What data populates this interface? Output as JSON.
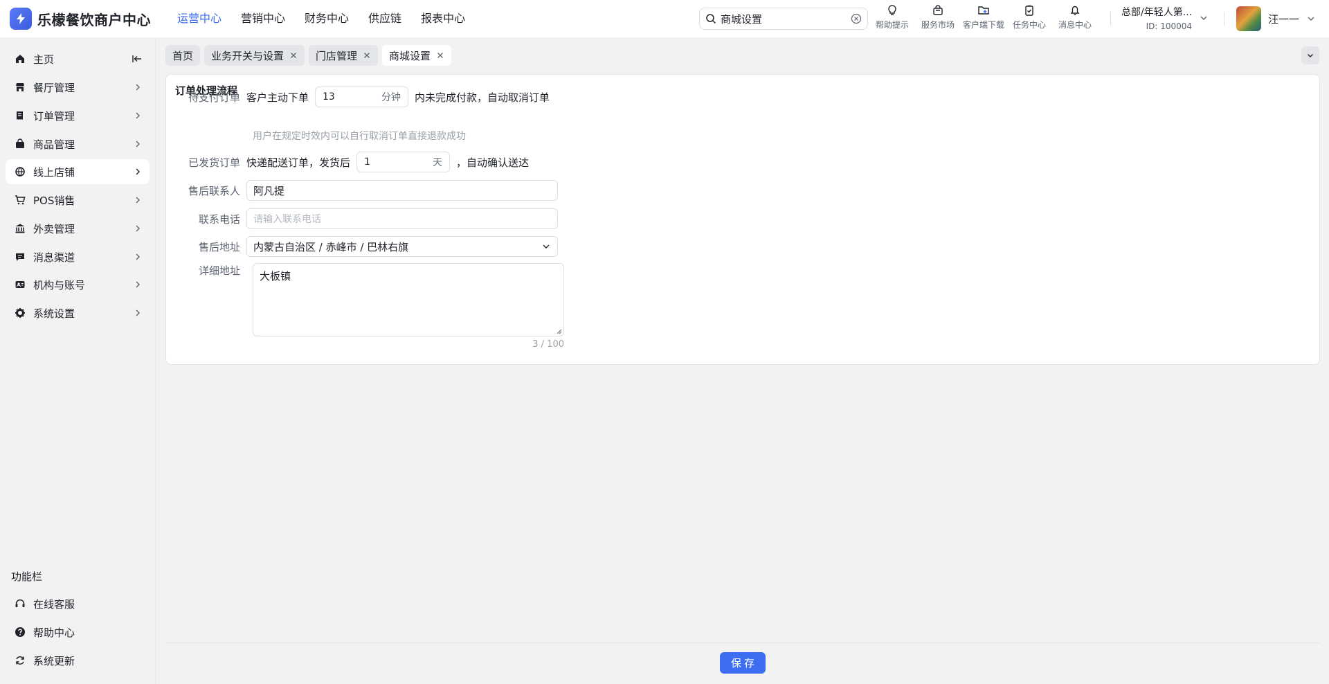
{
  "app": {
    "name": "乐檬餐饮商户中心"
  },
  "topnav": [
    "运营中心",
    "营销中心",
    "财务中心",
    "供应链",
    "报表中心"
  ],
  "search": {
    "value": "商城设置"
  },
  "tools": [
    {
      "label": "帮助提示",
      "icon": "lightbulb-icon"
    },
    {
      "label": "服务市场",
      "icon": "shopping-bag-icon"
    },
    {
      "label": "客户端下载",
      "icon": "folder-download-icon"
    },
    {
      "label": "任务中心",
      "icon": "clipboard-check-icon"
    },
    {
      "label": "消息中心",
      "icon": "bell-icon"
    }
  ],
  "org": {
    "name": "总部/年轻人第...",
    "id": "ID: 100004"
  },
  "user": {
    "name": "汪一一"
  },
  "sidebar": {
    "items": [
      {
        "label": "主页",
        "icon": "home-icon"
      },
      {
        "label": "餐厅管理",
        "icon": "store-icon"
      },
      {
        "label": "订单管理",
        "icon": "receipt-icon"
      },
      {
        "label": "商品管理",
        "icon": "bag-icon"
      },
      {
        "label": "线上店铺",
        "icon": "globe-icon"
      },
      {
        "label": "POS销售",
        "icon": "cart-icon"
      },
      {
        "label": "外卖管理",
        "icon": "bank-icon"
      },
      {
        "label": "消息渠道",
        "icon": "chat-icon"
      },
      {
        "label": "机构与账号",
        "icon": "id-card-icon"
      },
      {
        "label": "系统设置",
        "icon": "gear-icon"
      }
    ],
    "func_title": "功能栏",
    "func_items": [
      {
        "label": "在线客服",
        "icon": "headset-icon"
      },
      {
        "label": "帮助中心",
        "icon": "question-icon"
      },
      {
        "label": "系统更新",
        "icon": "refresh-icon"
      }
    ]
  },
  "tabs": [
    {
      "label": "首页"
    },
    {
      "label": "业务开关与设置"
    },
    {
      "label": "门店管理"
    },
    {
      "label": "商城设置"
    }
  ],
  "form": {
    "section_title": "订单处理流程",
    "pending": {
      "label": "待支付订单",
      "prefix": "客户主动下单",
      "value": "13",
      "unit": "分钟",
      "suffix": "内未完成付款，自动取消订单",
      "hint": "用户在规定时效内可以自行取消订单直接退款成功"
    },
    "shipped": {
      "label": "已发货订单",
      "prefix": "快递配送订单，发货后",
      "value": "1",
      "unit": "天",
      "suffix": "，自动确认送达"
    },
    "contact": {
      "label": "售后联系人",
      "value": "阿凡提"
    },
    "phone": {
      "label": "联系电话",
      "placeholder": "请输入联系电话"
    },
    "address": {
      "label": "售后地址",
      "value": "内蒙古自治区 / 赤峰市 / 巴林右旗"
    },
    "detail": {
      "label": "详细地址",
      "value": "大板镇",
      "counter": "3 / 100"
    }
  },
  "footer": {
    "save_label": "保存"
  },
  "colors": {
    "primary": "#3d6df0",
    "text": "#1f2329",
    "muted": "#5c6370",
    "bg": "#f2f2f3"
  }
}
